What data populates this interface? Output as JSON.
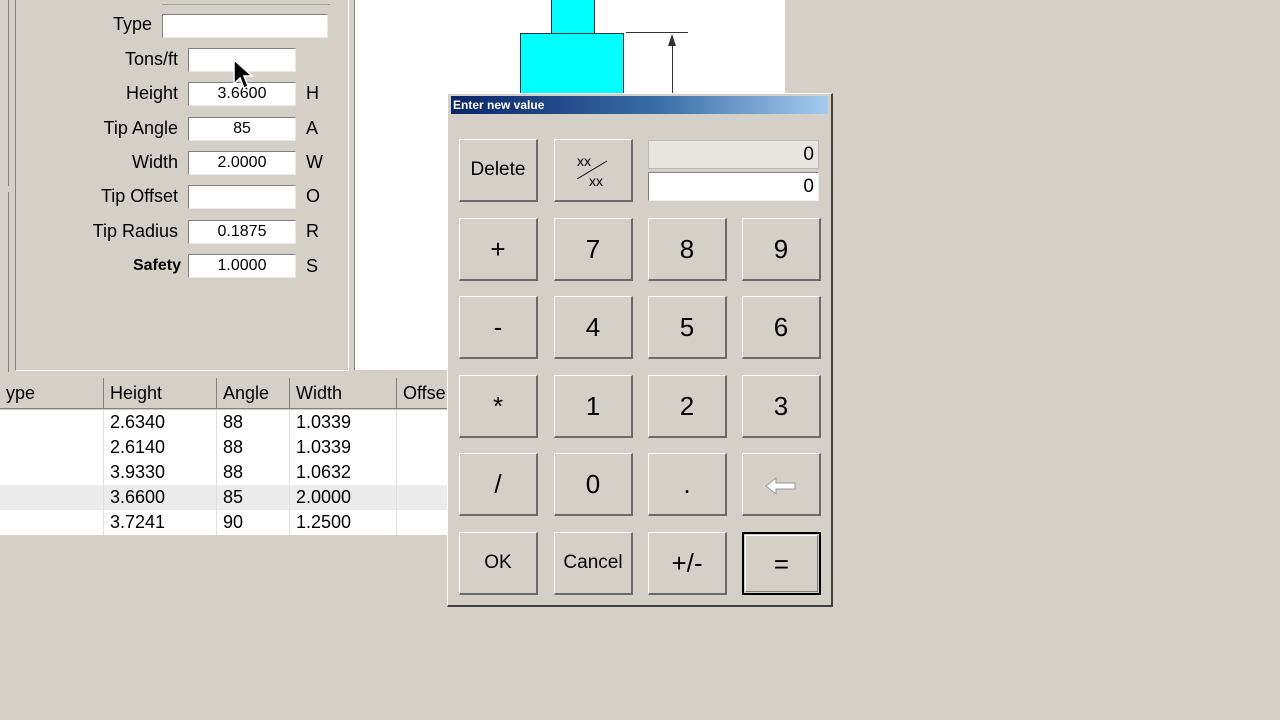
{
  "form": {
    "fields": [
      {
        "label": "Type",
        "value": "",
        "letter": ""
      },
      {
        "label": "Tons/ft",
        "value": "",
        "letter": ""
      },
      {
        "label": "Height",
        "value": "3.6600",
        "letter": "H"
      },
      {
        "label": "Tip Angle",
        "value": "85",
        "letter": "A"
      },
      {
        "label": "Width",
        "value": "2.0000",
        "letter": "W"
      },
      {
        "label": "Tip Offset",
        "value": "",
        "letter": "O"
      },
      {
        "label": "Tip Radius",
        "value": "0.1875",
        "letter": "R"
      },
      {
        "label": "Safety",
        "value": "1.0000",
        "letter": "S"
      }
    ]
  },
  "table": {
    "headers": [
      "ype",
      "Height",
      "Angle",
      "Width",
      "Offse"
    ],
    "rows": [
      [
        "",
        "2.6340",
        "88",
        "1.0339",
        ""
      ],
      [
        "",
        "2.6140",
        "88",
        "1.0339",
        ""
      ],
      [
        "",
        "3.9330",
        "88",
        "1.0632",
        ""
      ],
      [
        "",
        "3.6600",
        "85",
        "2.0000",
        ""
      ],
      [
        "",
        "3.7241",
        "90",
        "1.2500",
        ""
      ]
    ]
  },
  "dialog": {
    "title": "Enter new value",
    "display_top": "0",
    "display_bottom": "0",
    "buttons": {
      "delete": "Delete",
      "fraction": "xx/xx",
      "plus": "+",
      "minus": "-",
      "multiply": "*",
      "divide": "/",
      "d0": "0",
      "d1": "1",
      "d2": "2",
      "d3": "3",
      "d4": "4",
      "d5": "5",
      "d6": "6",
      "d7": "7",
      "d8": "8",
      "d9": "9",
      "dot": ".",
      "ok": "OK",
      "cancel": "Cancel",
      "plusminus": "+/-",
      "equals": "="
    }
  },
  "icons": {
    "backspace": "backspace-arrow-icon",
    "fraction": "fraction-icon",
    "cursor": "mouse-pointer-icon"
  },
  "colors": {
    "drawing_shape": "#00ffff",
    "titlebar_start": "#0a246a",
    "titlebar_end": "#a6caf0"
  }
}
